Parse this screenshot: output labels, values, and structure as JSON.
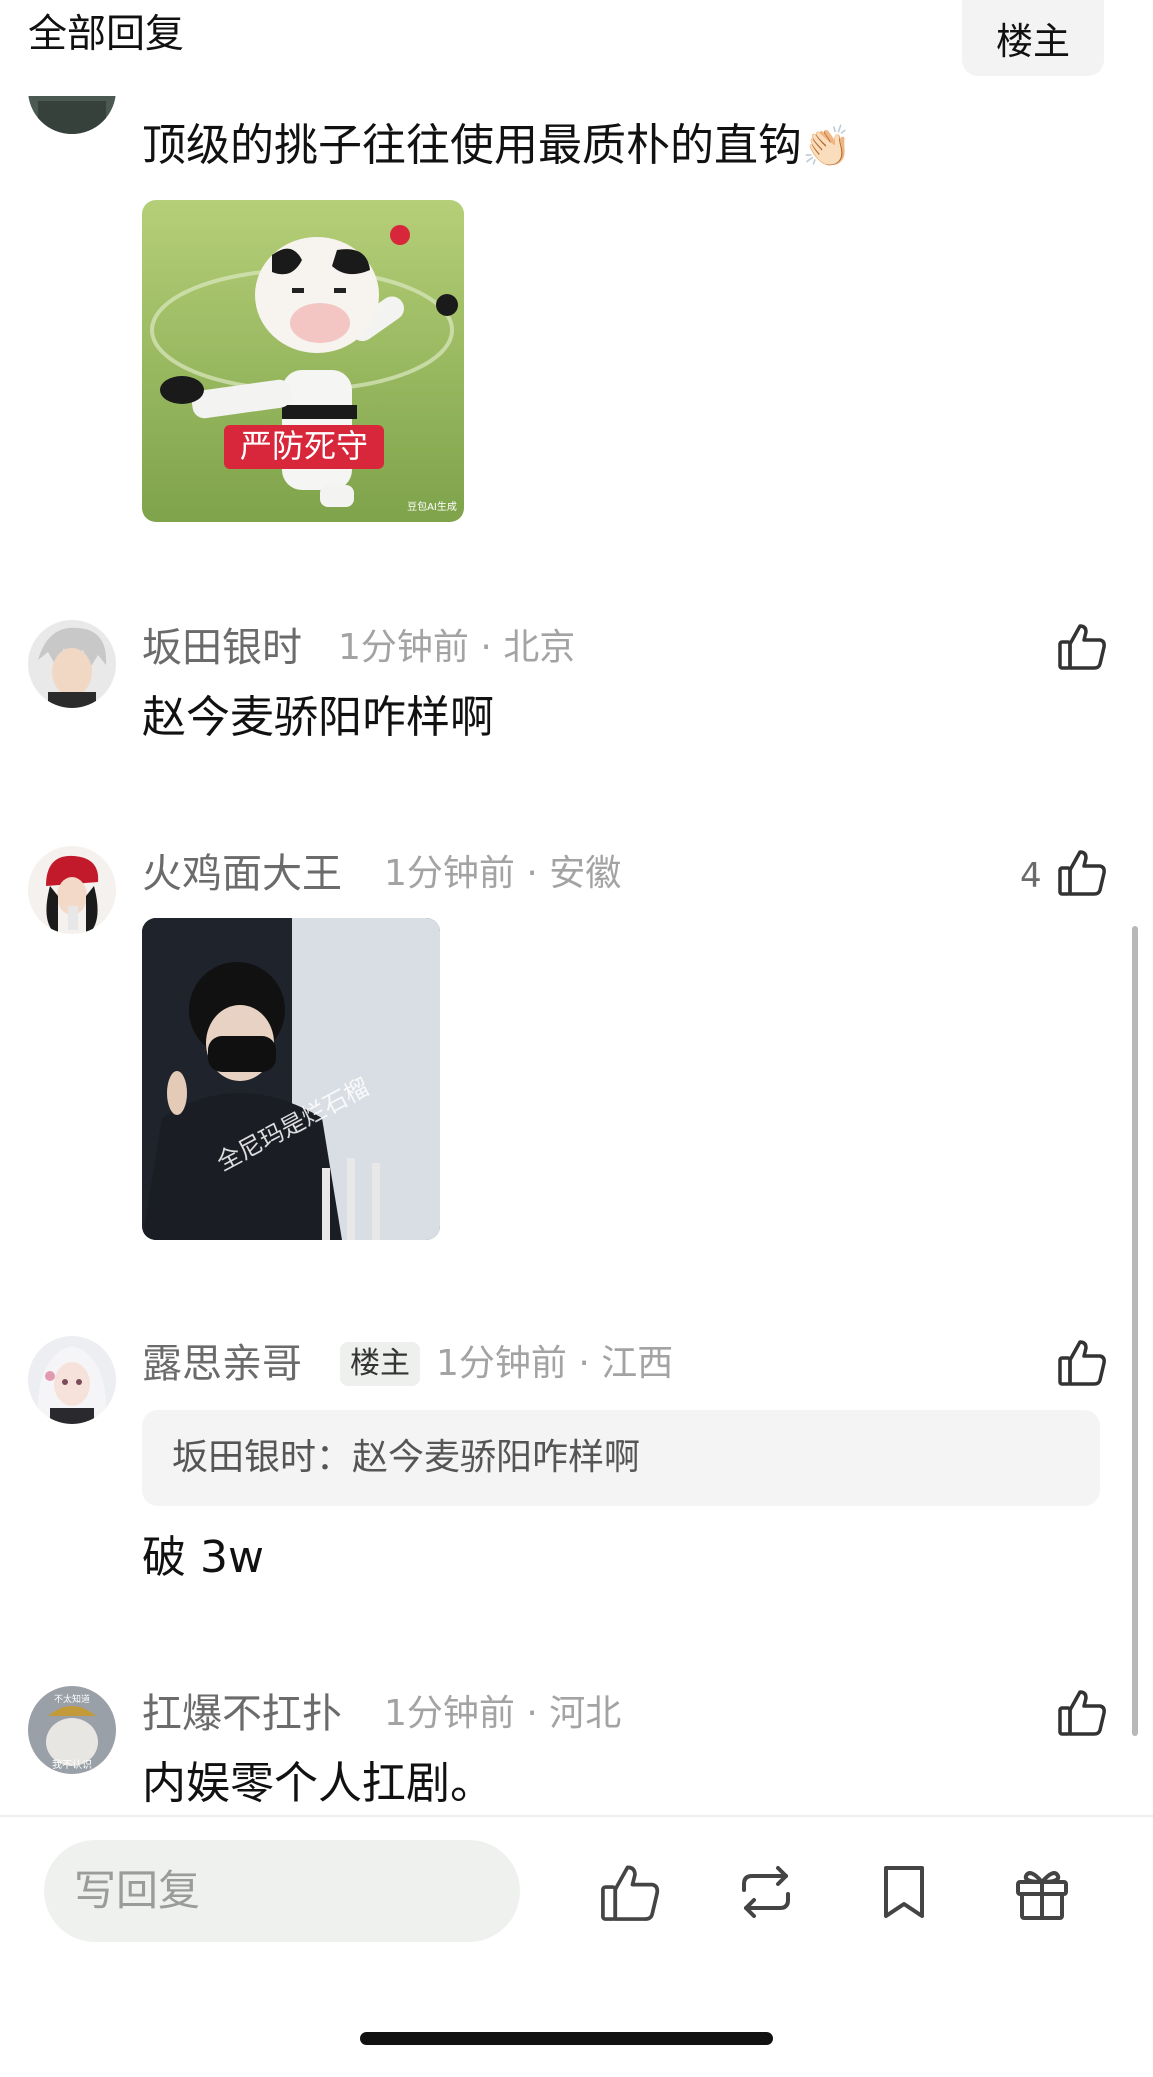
{
  "header": {
    "title": "全部回复",
    "op_button": "楼主"
  },
  "comments": [
    {
      "text": "顶级的挑子往往使用最质朴的直钩",
      "emoji": "👏🏻",
      "sticker_caption": "严防死守",
      "sticker_watermark": "豆包AI生成"
    },
    {
      "name": "坂田银时",
      "meta": "1分钟前 · 北京",
      "text": "赵今麦骄阳咋样啊"
    },
    {
      "name": "火鸡面大王",
      "meta": "1分钟前 · 安徽",
      "likes": "4",
      "photo_watermark": "全尼玛是烂石榴"
    },
    {
      "name": "露思亲哥",
      "tag": "楼主",
      "meta": "1分钟前 · 江西",
      "quote_author": "坂田银时：",
      "quote_text": "赵今麦骄阳咋样啊",
      "text": "破 3w"
    },
    {
      "name": "扛爆不扛扑",
      "meta": "1分钟前 · 河北",
      "text": "内娱零个人扛剧。",
      "avatar_badge_top": "不太知道",
      "avatar_badge_bottom": "我不认识"
    }
  ],
  "bottom_bar": {
    "reply_placeholder": "写回复",
    "icons": [
      "like-icon",
      "repost-icon",
      "bookmark-icon",
      "gift-icon"
    ]
  },
  "colors": {
    "meta_gray": "#a3a3a3",
    "name_gray": "#6b6b6b",
    "sticker_red": "#d8263a"
  }
}
